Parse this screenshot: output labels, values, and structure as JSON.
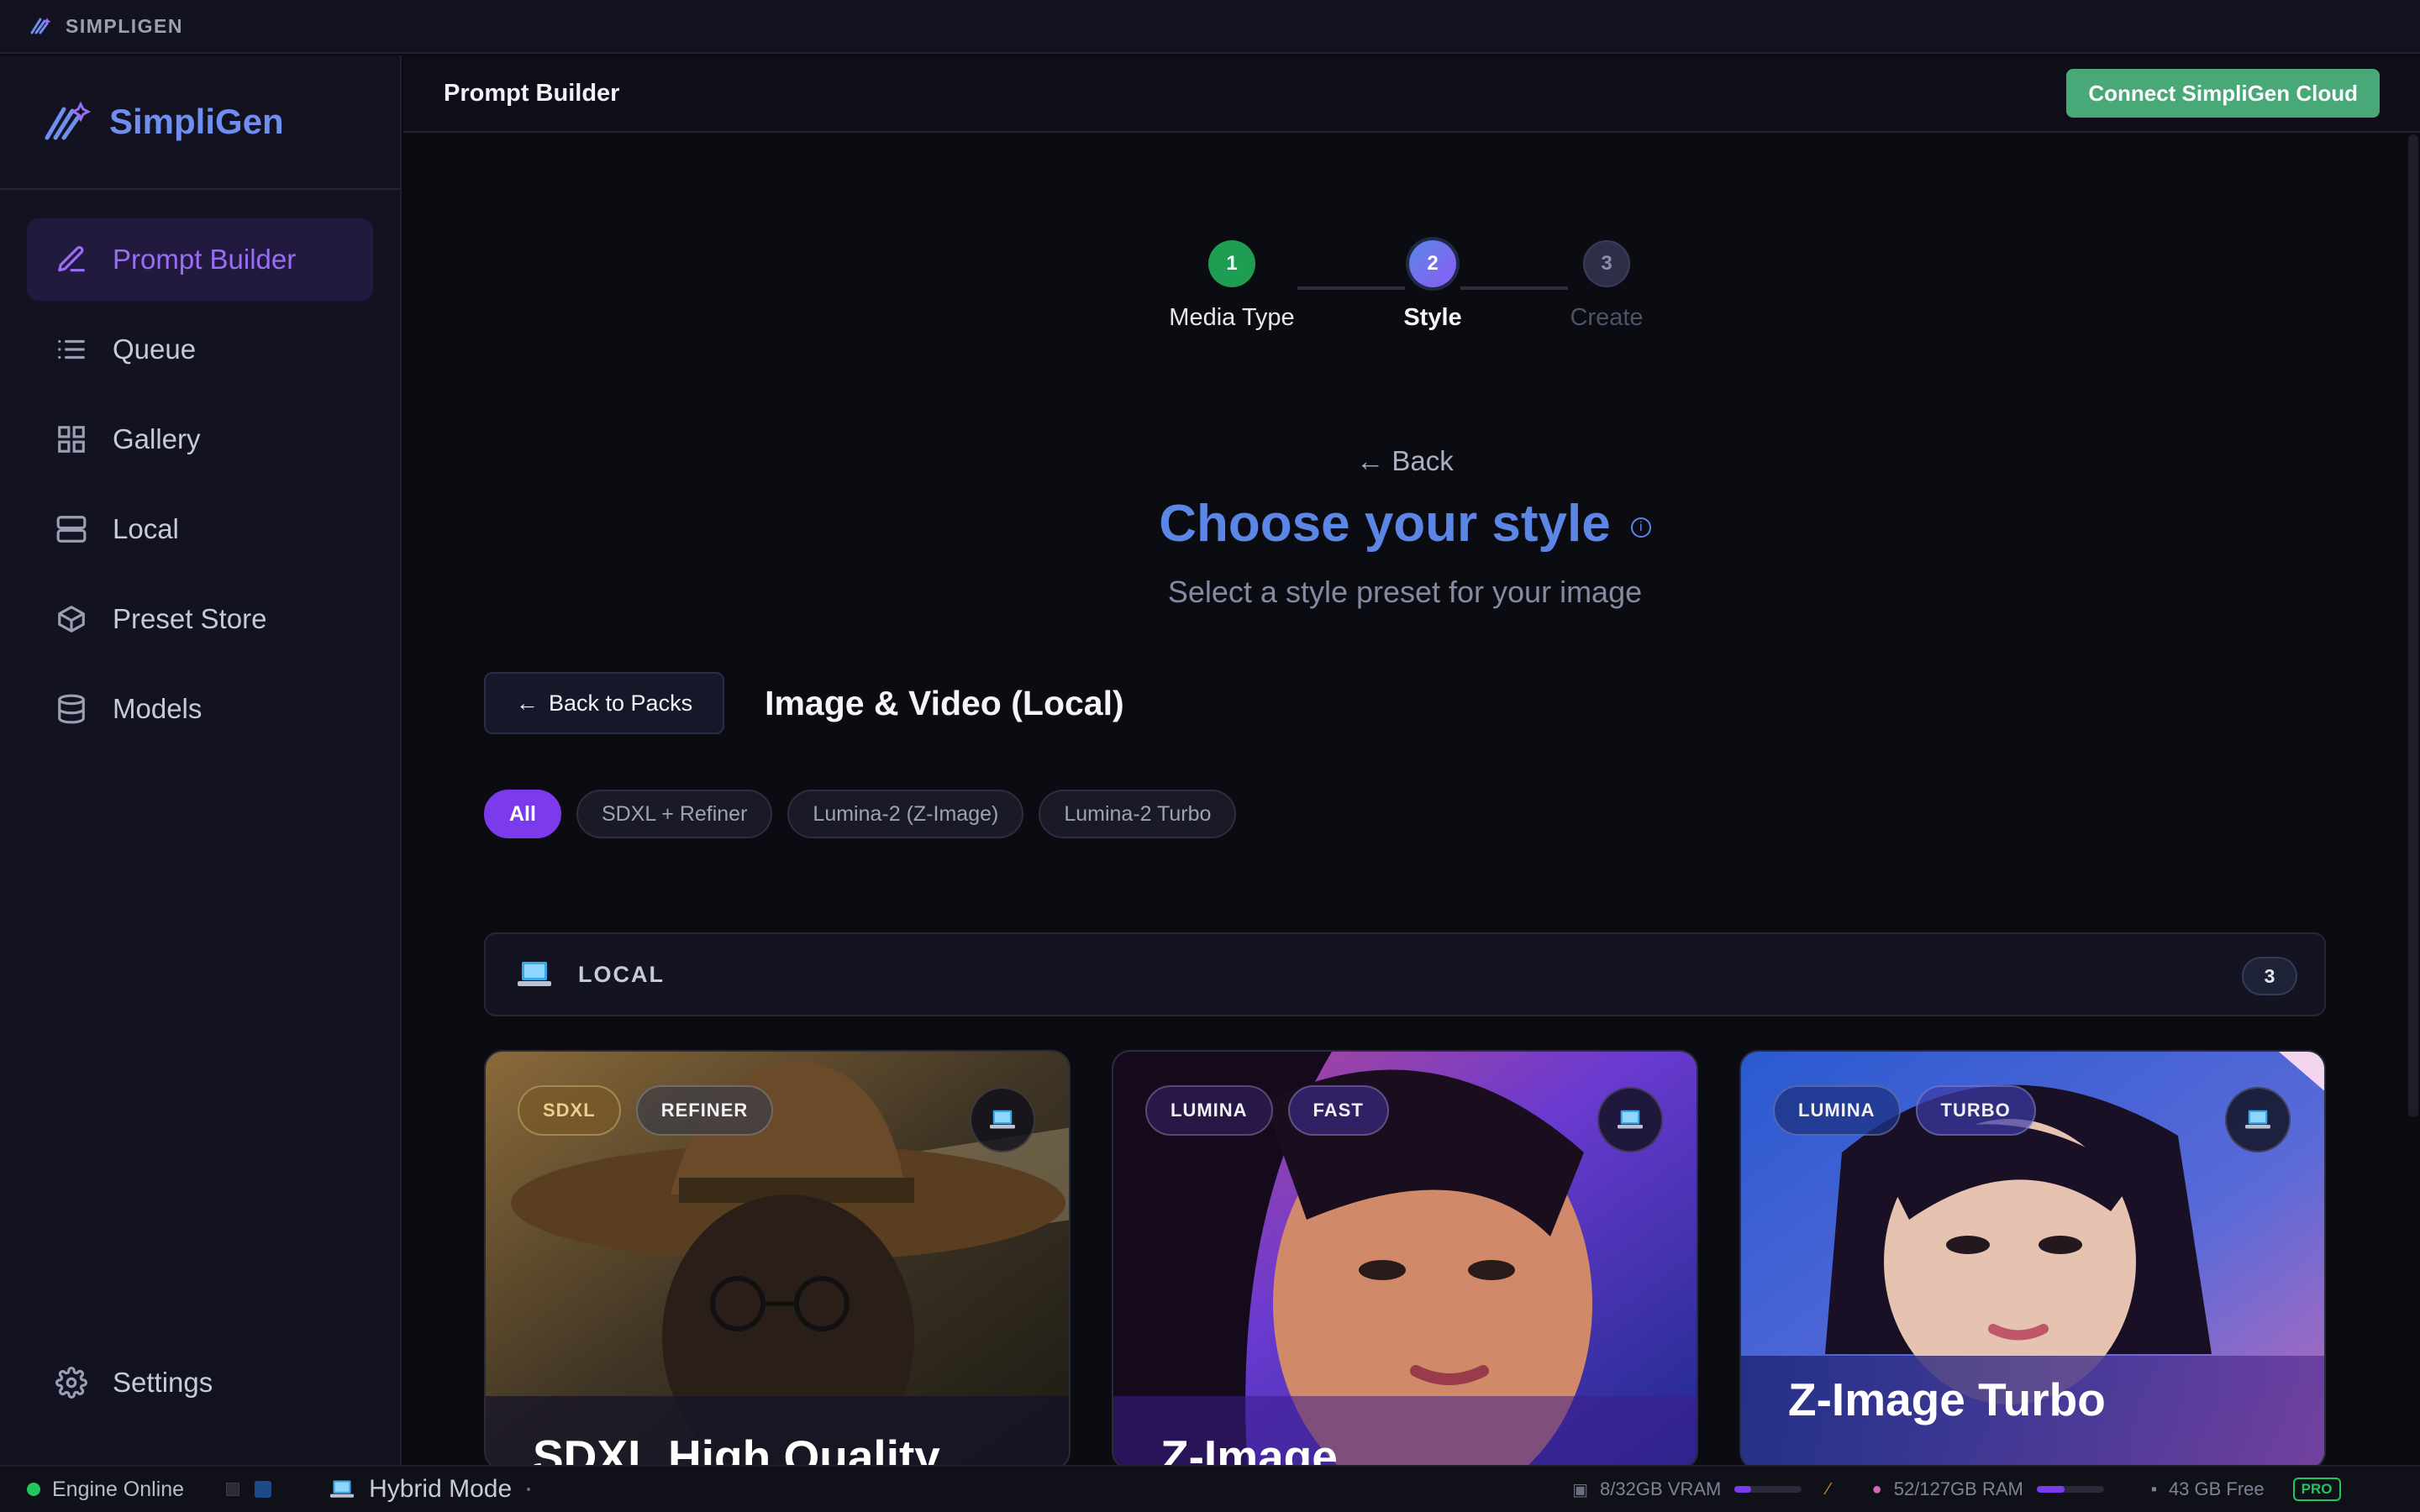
{
  "app": {
    "topbar_brand": "SIMPLIGEN",
    "logo_text": "SimpliGen"
  },
  "sidebar": {
    "items": [
      {
        "label": "Prompt Builder",
        "icon": "pencil-icon",
        "active": true
      },
      {
        "label": "Queue",
        "icon": "list-icon"
      },
      {
        "label": "Gallery",
        "icon": "grid-icon"
      },
      {
        "label": "Local",
        "icon": "server-icon"
      },
      {
        "label": "Preset Store",
        "icon": "box-icon"
      },
      {
        "label": "Models",
        "icon": "database-icon"
      }
    ],
    "settings_label": "Settings"
  },
  "header": {
    "title": "Prompt Builder",
    "connect_label": "Connect SimpliGen Cloud"
  },
  "stepper": {
    "steps": [
      {
        "number": "1",
        "label": "Media Type",
        "state": "done"
      },
      {
        "number": "2",
        "label": "Style",
        "state": "current"
      },
      {
        "number": "3",
        "label": "Create",
        "state": "upcoming"
      }
    ]
  },
  "style_page": {
    "back_label": "Back",
    "title": "Choose your style",
    "subtitle": "Select a style preset for your image",
    "back_to_packs_label": "Back to Packs",
    "pack_title": "Image & Video (Local)",
    "filters": [
      "All",
      "SDXL + Refiner",
      "Lumina-2 (Z-Image)",
      "Lumina-2 Turbo"
    ],
    "section": {
      "label": "LOCAL",
      "count": "3"
    },
    "cards": [
      {
        "title": "SDXL High Quality",
        "tags": [
          "SDXL",
          "REFINER"
        ]
      },
      {
        "title": "Z-Image",
        "tags": [
          "LUMINA",
          "FAST"
        ]
      },
      {
        "title": "Z-Image Turbo",
        "tags": [
          "LUMINA",
          "TURBO"
        ]
      }
    ]
  },
  "statusbar": {
    "engine": "Engine Online",
    "mode": "Hybrid Mode",
    "vram": "8/32GB VRAM",
    "vram_fraction": 0.25,
    "ram": "52/127GB RAM",
    "ram_fraction": 0.41,
    "disk": "43 GB Free",
    "plan": "PRO"
  },
  "colors": {
    "accent": "#7c3aed",
    "brand_blue": "#5b86e6",
    "success": "#22c55e",
    "connect": "#48a878"
  }
}
